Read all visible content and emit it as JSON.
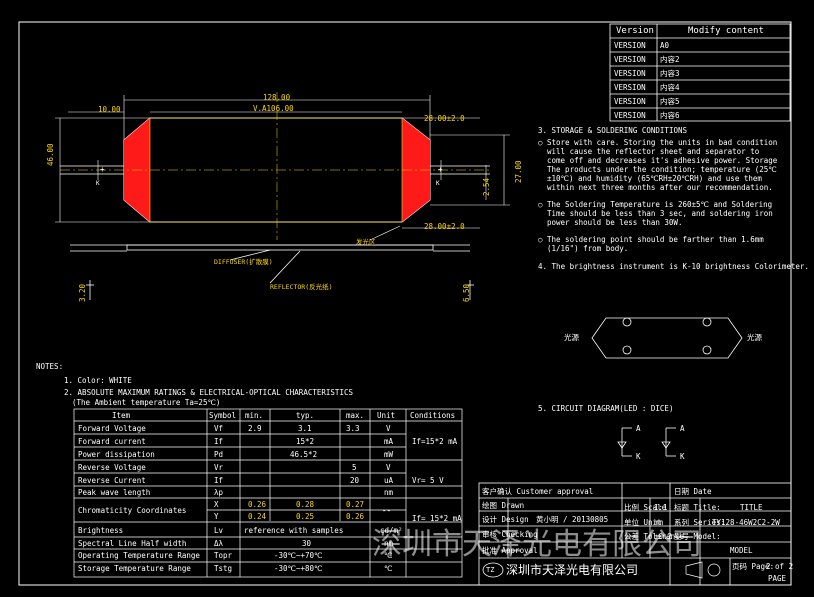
{
  "version_table": {
    "headers": [
      "Version",
      "Modify content"
    ],
    "rows": [
      [
        "VERSION",
        "A0"
      ],
      [
        "VERSION",
        "内容2"
      ],
      [
        "VERSION",
        "内容3"
      ],
      [
        "VERSION",
        "内容4"
      ],
      [
        "VERSION",
        "内容5"
      ],
      [
        "VERSION",
        "内容6"
      ]
    ]
  },
  "dimensions": {
    "total_length": "128.00",
    "inner_length": "V.A106.00",
    "end_offset": "10.00",
    "height": "46.00",
    "top_right": "28.00±2.0",
    "bottom_right": "28.00±2.0",
    "right_height": "27.00",
    "pin_space": "2.54",
    "side_left": "3.20",
    "side_right": "6.50",
    "pin_plus": "+",
    "pin_minus": "K"
  },
  "labels": {
    "light_area": "发光区",
    "diffuser": "DIFFUSER(扩散膜)",
    "reflector": "REFLECTOR(反光纸)"
  },
  "storage": {
    "title": "3. STORAGE & SOLDERING CONDITIONS",
    "bullets": [
      [
        "Store with care. Storing the units in bad condition",
        "will  cause  the reflector sheet and  separator  to",
        "come  off and decreases it's adhesive power. Storage",
        "The products under the condition; temperature (25℃",
        "±10℃)  and humidity  (65℃RH±20℃RH)  and use them",
        "within  next   three months after our recommendation."
      ],
      [
        "The Soldering Temperature is 260±5℃ and Soldering",
        "Time should  be less  than 3 sec, and soldering iron",
        "power should be less than 30W."
      ],
      [
        "The  soldering  point should  be  farther  than 1.6mm",
        "(1/16\") from body."
      ]
    ],
    "item4": "4. The brightness instrument is K-10 brightness Colorimeter."
  },
  "light_source": {
    "left": "光源",
    "right": "光源"
  },
  "circuit": {
    "title": "5. CIRCUIT DIAGRAM(LED : DICE)",
    "a": "A",
    "k": "K"
  },
  "notes": {
    "title": "NOTES:",
    "color": "1. Color: WHITE",
    "abs": "2. ABSOLUTE MAXIMUM RATINGS & ELECTRICAL-OPTICAL CHARACTERISTICS",
    "ambient": "(The Ambient temperature Ta=25℃)"
  },
  "spec_table": {
    "headers": [
      "Item",
      "Symbol",
      "min.",
      "typ.",
      "max.",
      "Unit",
      "Conditions"
    ],
    "rows": [
      [
        "Forward Voltage",
        "Vf",
        "2.9",
        "3.1",
        "3.3",
        "V"
      ],
      [
        "Forward current",
        "If",
        "",
        "15*2",
        "",
        "mA"
      ],
      [
        "Power dissipation",
        "Pd",
        "",
        "46.5*2",
        "",
        "mW"
      ],
      [
        "Reverse Voltage",
        "Vr",
        "",
        "",
        "5",
        "V"
      ],
      [
        "Reverse Current",
        "If",
        "",
        "",
        "20",
        "uA"
      ],
      [
        "Peak wave length",
        "λp",
        "",
        "",
        "",
        "nm"
      ],
      [
        "",
        "X",
        "0.26",
        "0.28",
        "0.27",
        ""
      ],
      [
        "",
        "Y",
        "0.24",
        "0.25",
        "0.26",
        ""
      ],
      [
        "Brightness",
        "Lv",
        "reference with samples",
        "",
        "",
        "cd/m²"
      ],
      [
        "Spectral Line Half width",
        "Δλ",
        "",
        "30",
        "",
        "nm"
      ],
      [
        "Operating Temperature Range",
        "Topr",
        "",
        "-30℃~+70℃",
        "",
        "℃"
      ],
      [
        "Storage Temperature Range",
        "Tstg",
        "",
        "-30℃~+80℃",
        "",
        "℃"
      ]
    ],
    "chroma_label": "Chromaticity Coordinates",
    "chroma_unit": "--",
    "cond1": "If=15*2 mA",
    "cond2": "Vr= 5  V",
    "cond3": "If= 15*2 mA"
  },
  "title_block": {
    "customer": "客户确认 Customer approval",
    "date": "日期 Date",
    "drawn": "绘图 Drawn",
    "design": "设计 Design",
    "design_val": "黄小明 / 20130805",
    "checking": "审核 Checking",
    "approval": "批准 Approval",
    "scale": "比例 Scale",
    "scale_val": "1:1",
    "unit": "单位 Unit",
    "unit_val": "mm",
    "tolerance": "公差 Tolerance",
    "tolerance_val": "±0.2",
    "title_lbl": "标题 Title:",
    "title_val": "TITLE",
    "series_lbl": "系列 Series:",
    "series_val": "TY128-46W2C2-2W",
    "model_lbl": "型号 Model:",
    "model_val": "MODEL",
    "page_lbl": "页码 Page:",
    "page_val": "2 of 2",
    "page_word": "PAGE",
    "company": "深圳市天泽光电有限公司",
    "logo": "TZ"
  },
  "watermark": "深圳市天泽光电有限公司"
}
